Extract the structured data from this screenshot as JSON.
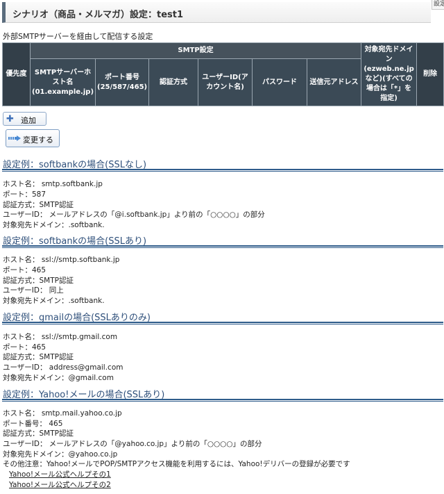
{
  "header": {
    "title": "シナリオ（商品・メルマガ）設定：test1",
    "corner_label": "設定"
  },
  "description": "外部SMTPサーバーを経由して配信する設定",
  "table": {
    "priority": "優先度",
    "group": "SMTP設定",
    "host": "SMTPサーバーホスト名(01.example.jp)",
    "port": "ポート番号(25/587/465)",
    "auth": "認証方式",
    "user": "ユーザーID(アカウント名)",
    "password": "パスワード",
    "sender": "送信元アドレス",
    "domain": "対象宛先ドメイン(ezweb.ne.jpなど)(すべての場合は「*」を指定)",
    "delete": "削除"
  },
  "buttons": {
    "add": "追加",
    "change": "変更する"
  },
  "examples": [
    {
      "heading": "設定例：softbankの場合(SSLなし)",
      "lines": [
        "ホスト名： smtp.softbank.jp",
        "ポート：587",
        "認証方式：SMTP認証",
        "ユーザーID： メールアドレスの「@i.softbank.jp」より前の「○○○○」の部分",
        "対象宛先ドメイン：.softbank."
      ]
    },
    {
      "heading": "設定例：softbankの場合(SSLあり)",
      "lines": [
        "ホスト名： ssl://smtp.softbank.jp",
        "ポート：465",
        "認証方式：SMTP認証",
        "ユーザーID： 同上",
        "対象宛先ドメイン：.softbank."
      ]
    },
    {
      "heading": "設定例：gmailの場合(SSLありのみ)",
      "lines": [
        "ホスト名： ssl://smtp.gmail.com",
        "ポート：465",
        "認証方式：SMTP認証",
        "ユーザーID： address@gmail.com",
        "対象宛先ドメイン：@gmail.com"
      ]
    },
    {
      "heading": "設定例：Yahoo!メールの場合(SSLあり)",
      "lines": [
        "ホスト名： smtp.mail.yahoo.co.jp",
        "ポート番号： 465",
        "認証方式：SMTP認証",
        "ユーザーID： メールアドレスの「@yahoo.co.jp」より前の「○○○○」の部分",
        "対象宛先ドメイン：@yahoo.co.jp",
        "その他注意：Yahoo!メールでPOP/SMTPアクセス機能を利用するには、Yahoo!デリバーの登録が必要です"
      ],
      "links": [
        "Yahoo!メール公式ヘルプその1",
        "Yahoo!メール公式ヘルプその2"
      ]
    }
  ]
}
